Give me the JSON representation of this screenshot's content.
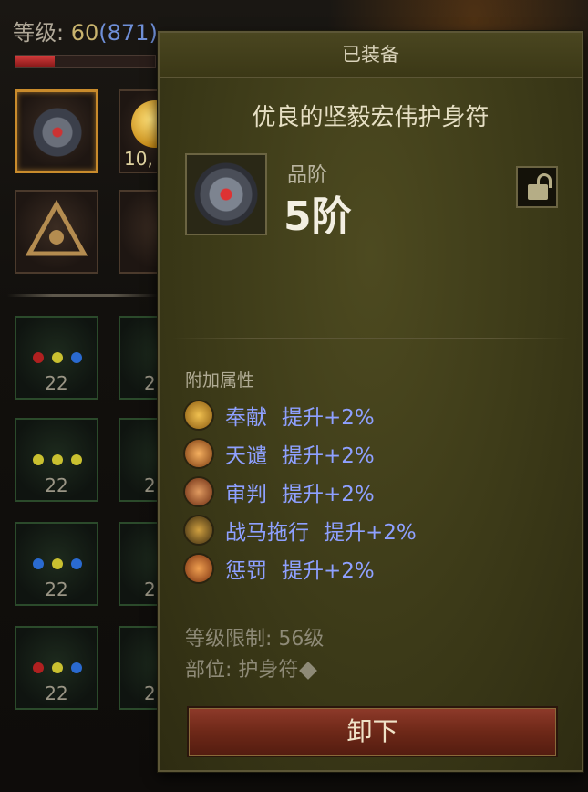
{
  "character": {
    "level_label": "等级:",
    "level_value": "60",
    "paragon": "(871)",
    "xp_progress": 0.28
  },
  "left_panel": {
    "gold_amount": "10,",
    "gem_slots": [
      {
        "count": "22"
      },
      {
        "count": "22"
      },
      {
        "count": "22"
      },
      {
        "count": "22"
      }
    ],
    "partial_counts": [
      "2",
      "2",
      "2",
      "2"
    ]
  },
  "tooltip": {
    "header": "已装备",
    "item_name": "优良的坚毅宏伟护身符",
    "grade_label": "品阶",
    "grade_value": "5阶",
    "attributes_title": "附加属性",
    "attributes": [
      {
        "name": "奉献",
        "effect": "提升+2%",
        "icon": "consecration-icon",
        "color": "#c98f2a"
      },
      {
        "name": "天谴",
        "effect": "提升+2%",
        "icon": "wrath-icon",
        "color": "#d98a3a"
      },
      {
        "name": "审判",
        "effect": "提升+2%",
        "icon": "judgment-icon",
        "color": "#b8642a"
      },
      {
        "name": "战马拖行",
        "effect": "提升+2%",
        "icon": "charger-icon",
        "color": "#9a6a25"
      },
      {
        "name": "惩罚",
        "effect": "提升+2%",
        "icon": "punish-icon",
        "color": "#c7702a"
      }
    ],
    "level_requirement": "等级限制: 56级",
    "slot": "部位: 护身符",
    "unequip_label": "卸下"
  },
  "colors": {
    "attribute_text": "#8ea0ff",
    "panel_bg": "#3c3a18",
    "button_red": "#6e2818"
  }
}
